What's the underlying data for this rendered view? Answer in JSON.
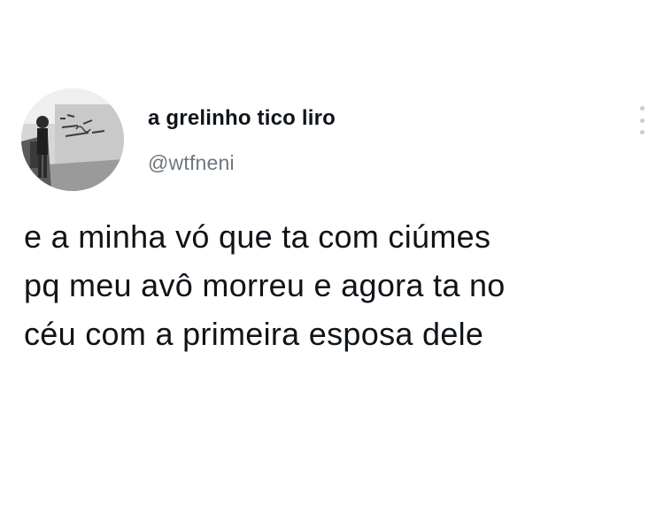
{
  "author": {
    "display_name": "a grelinho tico liro",
    "handle": "@wtfneni",
    "avatar_icon": "profile-photo-grayscale"
  },
  "menu": {
    "icon": "more-vertical-icon"
  },
  "tweet": {
    "lines": [
      "e a minha vó que ta com ciúmes",
      "pq meu avô morreu e agora ta no",
      "céu com a primeira esposa dele"
    ]
  },
  "colors": {
    "background": "#ffffff",
    "text": "#0f1419",
    "secondary_text": "#6e767d"
  }
}
